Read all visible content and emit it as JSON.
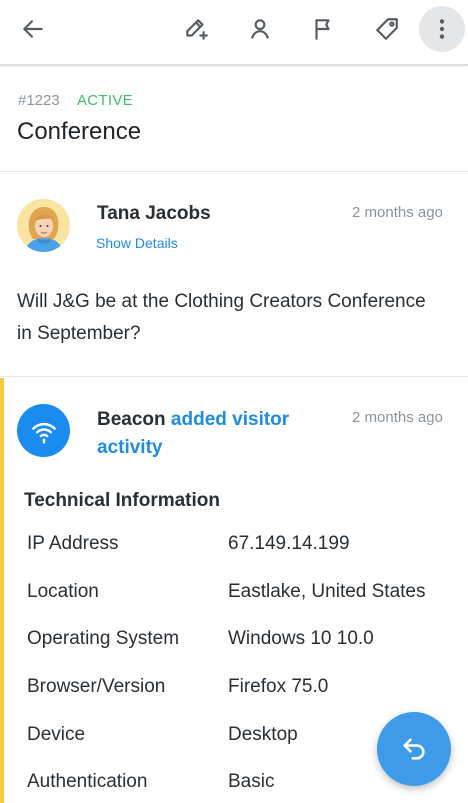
{
  "toolbar": {
    "icons": [
      "back-arrow-icon",
      "edit-add-icon",
      "person-icon",
      "flag-icon",
      "tag-icon",
      "more-vertical-icon"
    ]
  },
  "conversation": {
    "number": "#1223",
    "status": "ACTIVE",
    "subject": "Conference",
    "status_color": "#3cbf6b"
  },
  "thread": {
    "customer_name": "Tana Jacobs",
    "show_details_label": "Show Details",
    "time": "2 months ago",
    "body": "Will J&G be at the Clothing Creators Conference in September?"
  },
  "activity": {
    "actor": "Beacon",
    "verb": "added visitor activity",
    "time": "2 months ago",
    "accent_color": "#f6c844",
    "tech_heading": "Technical Information",
    "rows": [
      {
        "label": "IP Address",
        "value": "67.149.14.199"
      },
      {
        "label": "Location",
        "value": "Eastlake, United States"
      },
      {
        "label": "Operating System",
        "value": "Windows 10 10.0"
      },
      {
        "label": "Browser/Version",
        "value": "Firefox 75.0"
      },
      {
        "label": "Device",
        "value": "Desktop"
      },
      {
        "label": "Authentication",
        "value": "Basic"
      }
    ]
  },
  "fab": {
    "icon": "reply-icon"
  }
}
